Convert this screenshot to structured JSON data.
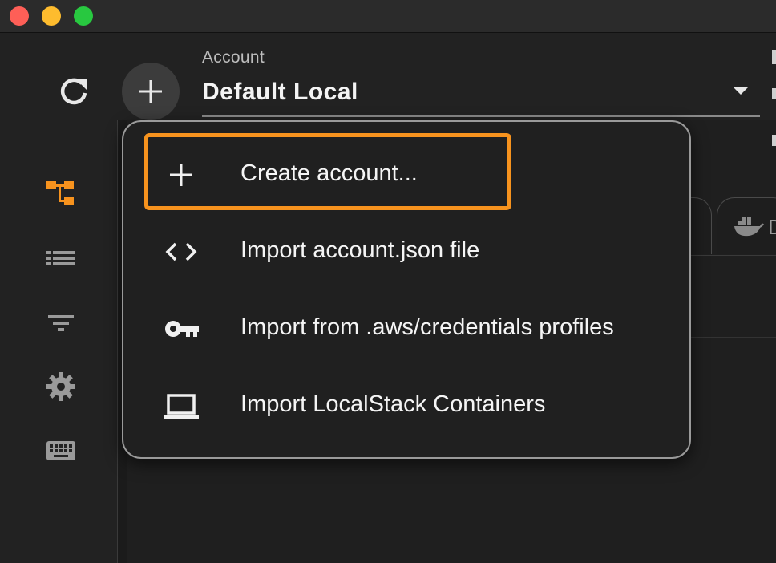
{
  "window": {
    "controls": [
      "close",
      "minimize",
      "maximize"
    ]
  },
  "toolbar": {
    "refresh_icon": "refresh-icon",
    "add_icon": "plus-icon"
  },
  "account": {
    "label": "Account",
    "selected_value": "Default Local"
  },
  "sidebar": {
    "items": [
      {
        "icon": "tree-hierarchy-icon",
        "active": true
      },
      {
        "icon": "list-icon",
        "active": false
      },
      {
        "icon": "filter-icon",
        "active": false
      },
      {
        "icon": "gear-icon",
        "active": false
      },
      {
        "icon": "keyboard-icon",
        "active": false
      }
    ]
  },
  "background_tab": {
    "letter": "D",
    "icon": "docker-icon"
  },
  "menu": {
    "items": [
      {
        "label": "Create account...",
        "icon": "plus-icon",
        "highlighted": true
      },
      {
        "label": "Import account.json file",
        "icon": "code-brackets-icon"
      },
      {
        "label": "Import from .aws/credentials profiles",
        "icon": "key-icon"
      },
      {
        "label": "Import LocalStack Containers",
        "icon": "laptop-icon"
      }
    ]
  },
  "colors": {
    "accent": "#f7931e",
    "background": "#222222",
    "menu_background": "#202020",
    "text": "#f5f5f5"
  }
}
